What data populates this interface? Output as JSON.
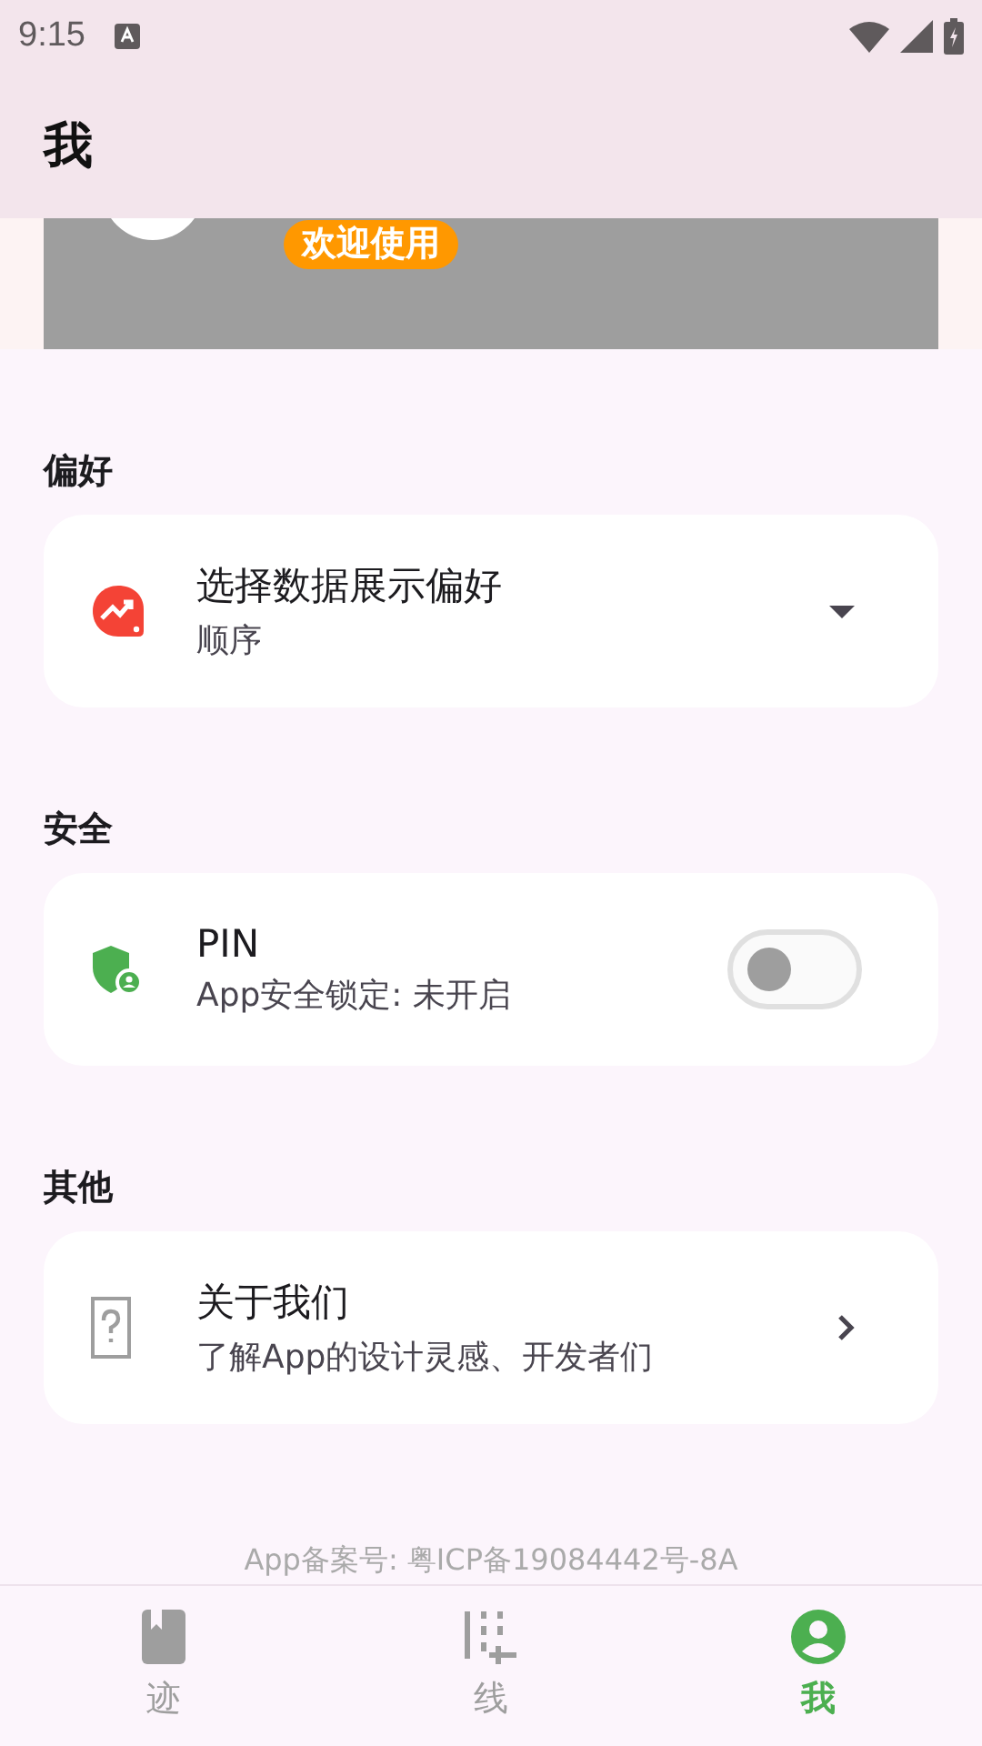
{
  "status_bar": {
    "time": "9:15"
  },
  "app_bar": {
    "title": "我"
  },
  "banner": {
    "badge": "欢迎使用"
  },
  "sections": [
    {
      "title": "偏好",
      "item": {
        "kind": "dropdown",
        "title": "选择数据展示偏好",
        "subtitle": "顺序"
      }
    },
    {
      "title": "安全",
      "item": {
        "kind": "switch",
        "title": "PIN",
        "subtitle": "App安全锁定: 未开启",
        "on": false
      }
    },
    {
      "title": "其他",
      "item": {
        "kind": "link",
        "title": "关于我们",
        "subtitle": "了解App的设计灵感、开发者们"
      }
    }
  ],
  "footer": "App备案号: 粤ICP备19084442号-8A",
  "bottom_nav": [
    {
      "label": "迹",
      "selected": false
    },
    {
      "label": "线",
      "selected": false
    },
    {
      "label": "我",
      "selected": true
    }
  ]
}
